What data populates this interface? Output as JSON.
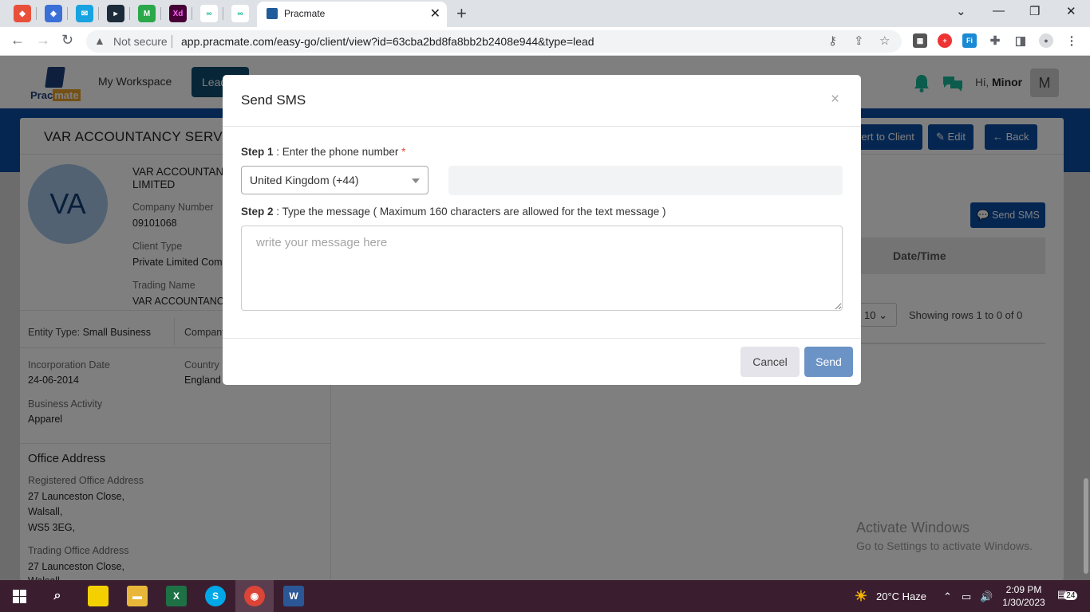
{
  "browser": {
    "tab_title": "Pracmate",
    "url": "app.pracmate.com/easy-go/client/view?id=63cba2bd8fa8bb2b2408e944&type=lead",
    "security_label": "Not secure"
  },
  "app": {
    "logo_prefix": "Prac",
    "logo_suffix": "mate",
    "nav_workspace": "My Workspace",
    "nav_active": "Leads",
    "greeting_prefix": "Hi,",
    "user_name": "Minor",
    "user_initial": "M"
  },
  "client": {
    "title": "VAR ACCOUNTANCY SERVICES LIMITED",
    "initials": "VA",
    "name_line1": "VAR ACCOUNTANCY SERVICES",
    "name_line2": "LIMITED",
    "company_number_label": "Company Number",
    "company_number": "09101068",
    "client_type_label": "Client Type",
    "client_type": "Private Limited Company",
    "trading_name_label": "Trading Name",
    "trading_name": "VAR ACCOUNTANCY SERVICES",
    "entity_type_label": "Entity Type:",
    "entity_type": "Small Business",
    "company_status_label": "Company Status:",
    "incorporation_label": "Incorporation Date",
    "incorporation_date": "24-06-2014",
    "country_label": "Country",
    "country": "England",
    "business_activity_label": "Business Activity",
    "business_activity": "Apparel",
    "office_section": "Office Address",
    "registered_label": "Registered Office Address",
    "registered_lines": [
      "27 Launceston Close,",
      "Walsall,",
      "WS5 3EG,"
    ],
    "trading_office_label": "Trading Office Address",
    "trading_office_lines": [
      "27 Launceston Close,",
      "Walsall,"
    ]
  },
  "actions": {
    "convert": "Convert to Client",
    "edit": "Edit",
    "back": "Back",
    "send_sms": "Send SMS"
  },
  "table": {
    "date_header": "Date/Time",
    "page_size": "10",
    "rows_info": "Showing rows 1 to  0 of 0"
  },
  "modal": {
    "title": "Send SMS",
    "close": "×",
    "step1_prefix": "Step 1",
    "step1_text": " : Enter the phone number ",
    "required": "*",
    "country_value": "United Kingdom (+44)",
    "phone_value": "",
    "step2_prefix": "Step 2",
    "step2_text": " : Type the message ( Maximum 160 characters are allowed for the text message )",
    "message_placeholder": "write your message here",
    "cancel": "Cancel",
    "send": "Send"
  },
  "watermark": {
    "line1": "Activate Windows",
    "line2": "Go to Settings to activate Windows."
  },
  "taskbar": {
    "weather": "20°C  Haze",
    "time": "2:09 PM",
    "date": "1/30/2023",
    "notifications": "24"
  },
  "colors": {
    "brand_blue": "#0b4da2",
    "active_nav": "#0f4c6e",
    "send_button": "#6b93c6",
    "notification_green": "#18b99a"
  }
}
